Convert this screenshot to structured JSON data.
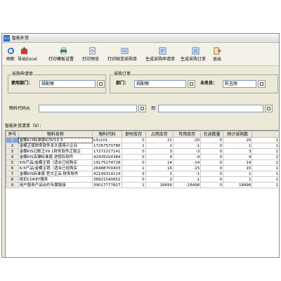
{
  "window": {
    "title": "智能补货",
    "icon_text": "K/3"
  },
  "toolbar": {
    "buttons": [
      {
        "label": "刷新",
        "icon": "refresh-icon",
        "color": "#2f7ad1"
      },
      {
        "label": "导出Excel",
        "icon": "export-excel-icon",
        "color": "#cf3b2b"
      },
      {
        "label": "打印模板设置",
        "icon": "print-template-icon",
        "color": "#3d8f3d"
      },
      {
        "label": "打印预览",
        "icon": "print-preview-icon",
        "color": "#6f6f6f"
      },
      {
        "label": "打印缺货采购单",
        "icon": "print-shortage-icon",
        "color": "#4a7fb8"
      },
      {
        "label": "生成采购申请单",
        "icon": "purchase-request-icon",
        "color": "#4a7fb8"
      },
      {
        "label": "生成采购订单",
        "icon": "purchase-order-icon",
        "color": "#4a7fb8"
      },
      {
        "label": "退出",
        "icon": "exit-icon",
        "color": "#c43a3a"
      }
    ]
  },
  "request_group": {
    "legend": "采购申请单",
    "dept_label": "使用部门：",
    "dept_value": "规配哪"
  },
  "order_group": {
    "legend": "采购订单",
    "dept_label": "部门：",
    "dept_value": "规配哪",
    "staff_label": "业务员：",
    "staff_value": "陈丑丽"
  },
  "filter": {
    "from_label": "物料代码从",
    "from_value": "",
    "to_label": "到",
    "to_value": ""
  },
  "grid": {
    "caption": "智能补货清单（9）：",
    "columns": [
      "序号",
      "物料名称",
      "物料代码",
      "即时库存",
      "占用库存",
      "可用库存",
      "在途数量",
      "预计采购数",
      ""
    ],
    "rows": [
      [
        "1",
        "金蝶K/3标准版K/3V10.3",
        "k3v101",
        "0",
        "21",
        "-20",
        "0",
        "20",
        "1"
      ],
      [
        "2",
        "金蝶正版财务软件永久使用小企业",
        "17267570786",
        "1",
        "2",
        "-1",
        "0",
        "1",
        "1"
      ],
      [
        "3",
        "金蝶KIS记账王V9.1财务软件正版企",
        "17272217141",
        "0",
        "3",
        "-3",
        "0",
        "3",
        "1"
      ],
      [
        "4",
        "金蝶KIS店铺标准版 进销存软件",
        "42435024384",
        "0",
        "4",
        "-4",
        "0",
        "4",
        "2"
      ],
      [
        "5",
        "KIS产品/金蝶主销（适合已经购买",
        "19175274728",
        "0",
        "14",
        "-14",
        "0",
        "14",
        "1"
      ],
      [
        "6",
        "K/3产品/金蝶主销（适合已经购买",
        "26488700403",
        "1",
        "16",
        "-15",
        "0",
        "15",
        "1"
      ],
      [
        "7",
        "金蝶KIS标准版 官方正品 财务软件",
        "42199314114",
        "0",
        "1",
        "-1",
        "0",
        "1",
        "1"
      ],
      [
        "8",
        "抵扣CDKEY服务",
        "38921540652",
        "0",
        "2",
        "-1",
        "0",
        "1",
        "1"
      ],
      [
        "9",
        "用户服务产品合约专属链接",
        "39017777827",
        "1",
        "18499",
        "-18498",
        "0",
        "18498",
        "1"
      ]
    ]
  },
  "colors": {
    "window_bg": "#ece9d8",
    "selected_row": "#7fa6d8"
  }
}
